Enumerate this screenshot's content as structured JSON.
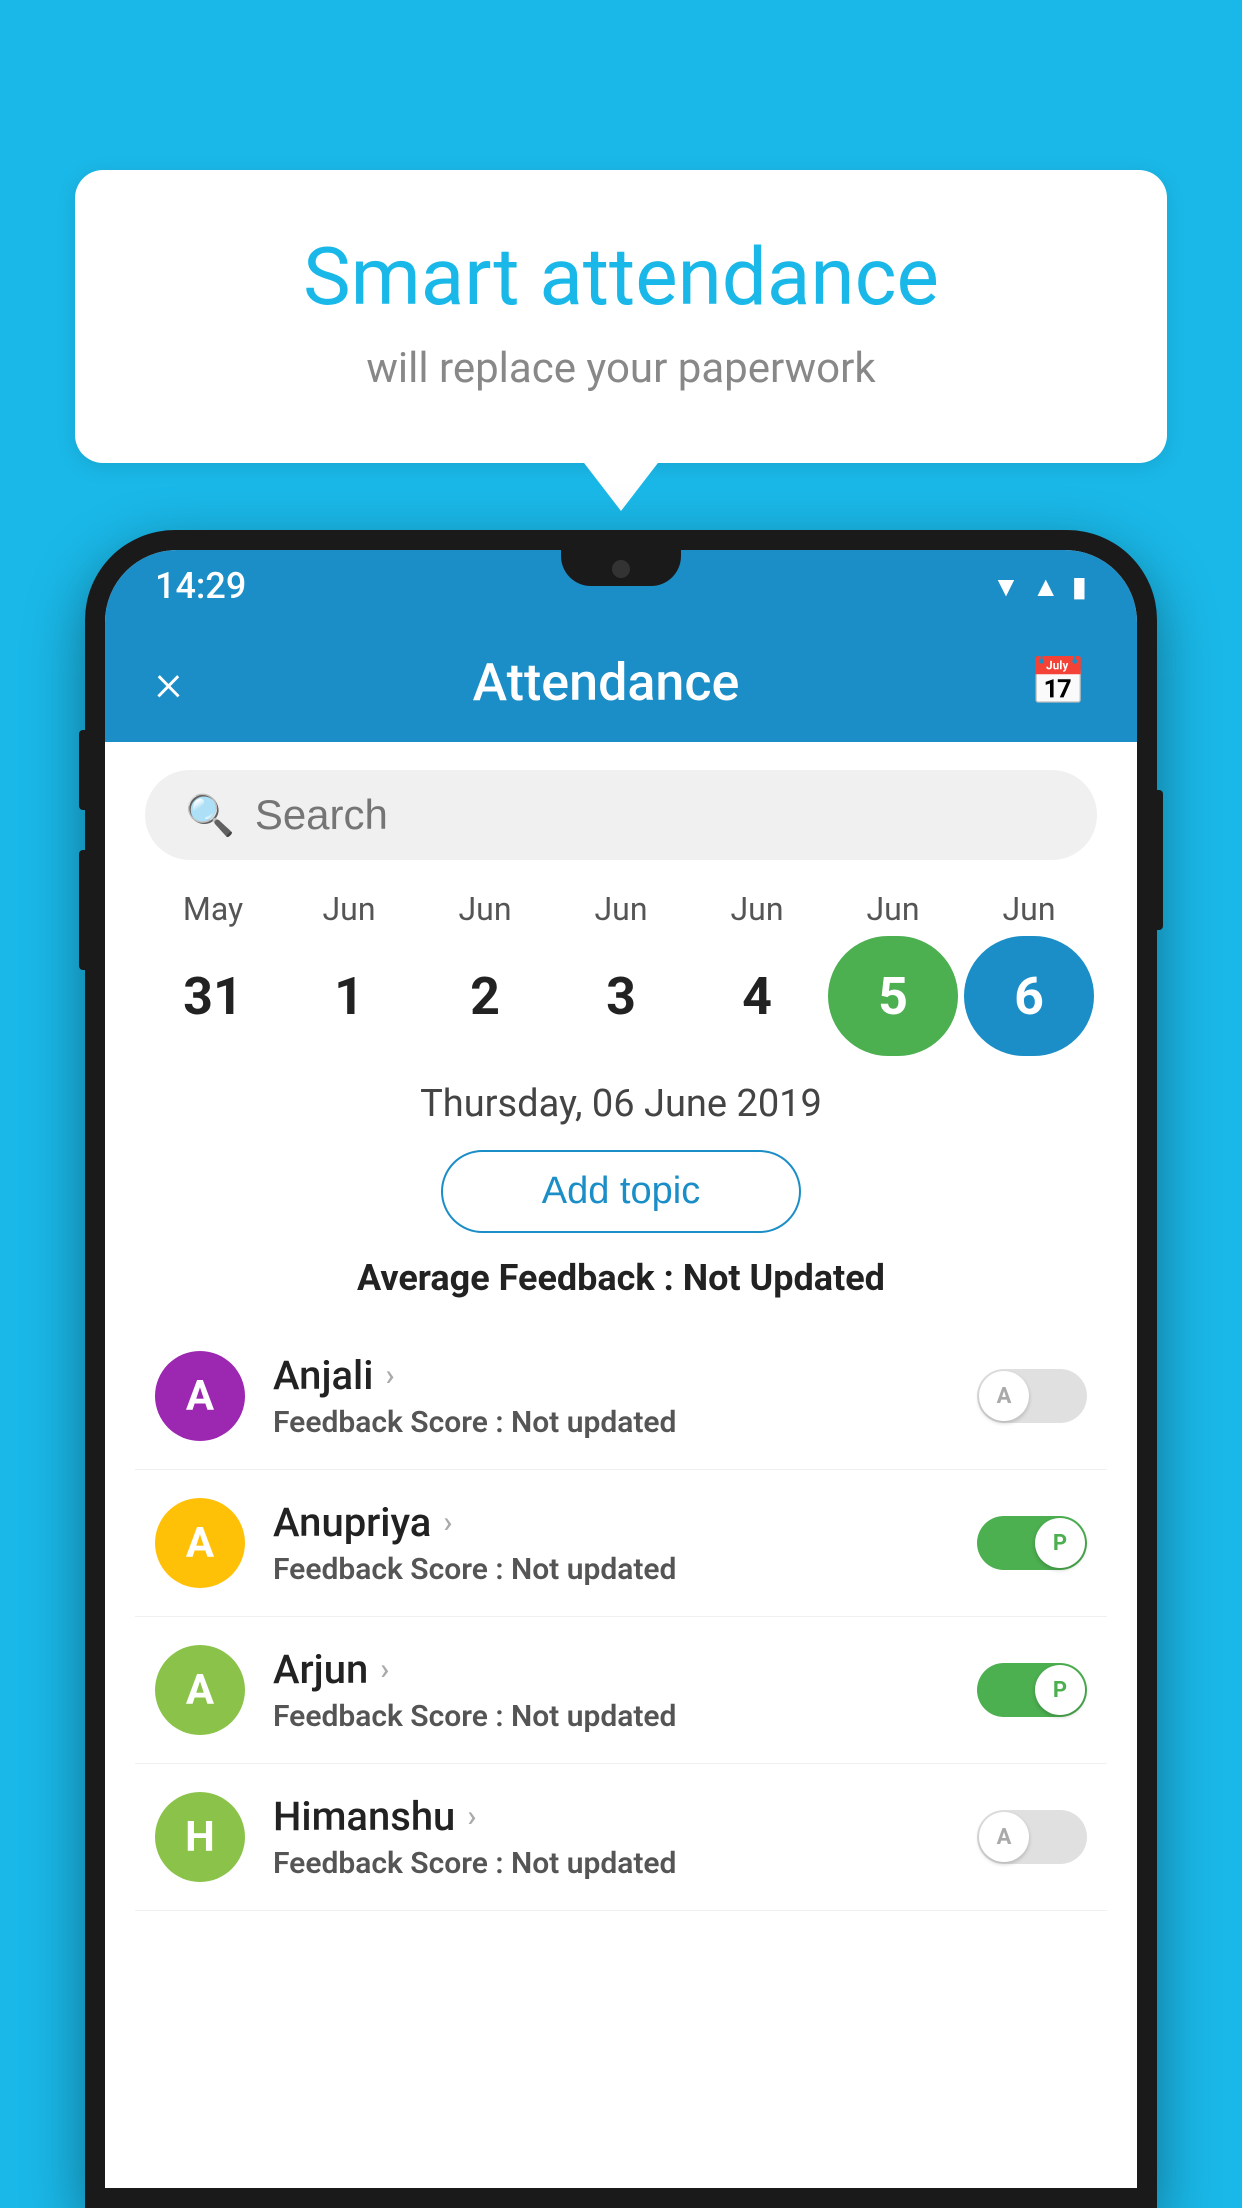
{
  "background_color": "#1ab8e8",
  "bubble": {
    "title": "Smart attendance",
    "subtitle": "will replace your paperwork"
  },
  "status_bar": {
    "time": "14:29",
    "icons": [
      "wifi",
      "signal",
      "battery"
    ]
  },
  "header": {
    "title": "Attendance",
    "close_label": "×",
    "calendar_icon": "📅"
  },
  "search": {
    "placeholder": "Search"
  },
  "calendar": {
    "months": [
      "May",
      "Jun",
      "Jun",
      "Jun",
      "Jun",
      "Jun",
      "Jun"
    ],
    "dates": [
      "31",
      "1",
      "2",
      "3",
      "4",
      "5",
      "6"
    ],
    "today_index": 5,
    "selected_index": 6
  },
  "date_label": "Thursday, 06 June 2019",
  "add_topic_label": "Add topic",
  "avg_feedback_label": "Average Feedback :",
  "avg_feedback_value": "Not Updated",
  "students": [
    {
      "name": "Anjali",
      "avatar_letter": "A",
      "avatar_color": "#9c27b0",
      "feedback_label": "Feedback Score :",
      "feedback_value": "Not updated",
      "toggle_state": "off",
      "toggle_label": "A"
    },
    {
      "name": "Anupriya",
      "avatar_letter": "A",
      "avatar_color": "#ffc107",
      "feedback_label": "Feedback Score :",
      "feedback_value": "Not updated",
      "toggle_state": "on",
      "toggle_label": "P"
    },
    {
      "name": "Arjun",
      "avatar_letter": "A",
      "avatar_color": "#8bc34a",
      "feedback_label": "Feedback Score :",
      "feedback_value": "Not updated",
      "toggle_state": "on",
      "toggle_label": "P"
    },
    {
      "name": "Himanshu",
      "avatar_letter": "H",
      "avatar_color": "#8bc34a",
      "feedback_label": "Feedback Score :",
      "feedback_value": "Not updated",
      "toggle_state": "off",
      "toggle_label": "A"
    }
  ]
}
